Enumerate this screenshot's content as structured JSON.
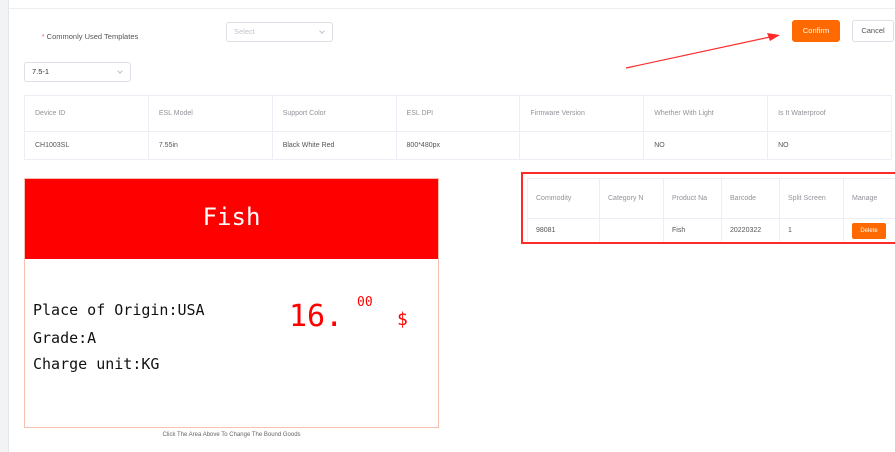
{
  "form": {
    "template_label": "Commonly Used Templates",
    "required_mark": "*",
    "template_select": {
      "placeholder": "Select"
    },
    "template_value_select": {
      "value": "7.5-1"
    }
  },
  "actions": {
    "confirm_label": "Confirm",
    "cancel_label": "Cancel"
  },
  "annotation": {
    "arrow_color": "#ff2a2a"
  },
  "device_table": {
    "headers": [
      "Device ID",
      "ESL Model",
      "Support Color",
      "ESL DPI",
      "Firmware Version",
      "Whether With Light",
      "Is It Waterproof"
    ],
    "rows": [
      [
        "CH1003SL",
        "7.55in",
        "Black White Red",
        "800*480px",
        "",
        "NO",
        "NO"
      ]
    ]
  },
  "esl_preview": {
    "title": "Fish",
    "lines": [
      "Place of Origin:USA",
      "Grade:A",
      "Charge unit:KG"
    ],
    "price_integer": "16.",
    "price_decimal": "00",
    "currency": "$",
    "colors": {
      "red": "#ff0000",
      "black": "#111111",
      "white": "#ffffff"
    }
  },
  "hint_text": "Click The Area Above To Change The Bound Goods",
  "goods_table": {
    "headers": [
      "Commodity",
      "Category N",
      "Product Na",
      "Barcode",
      "Split Screen",
      "Manage"
    ],
    "rows": [
      [
        "98081",
        "",
        "Fish",
        "20220322",
        "1"
      ]
    ],
    "delete_label": "Delete"
  },
  "colors": {
    "accent": "#ff6a00",
    "highlight_border": "#ff2a2a"
  }
}
